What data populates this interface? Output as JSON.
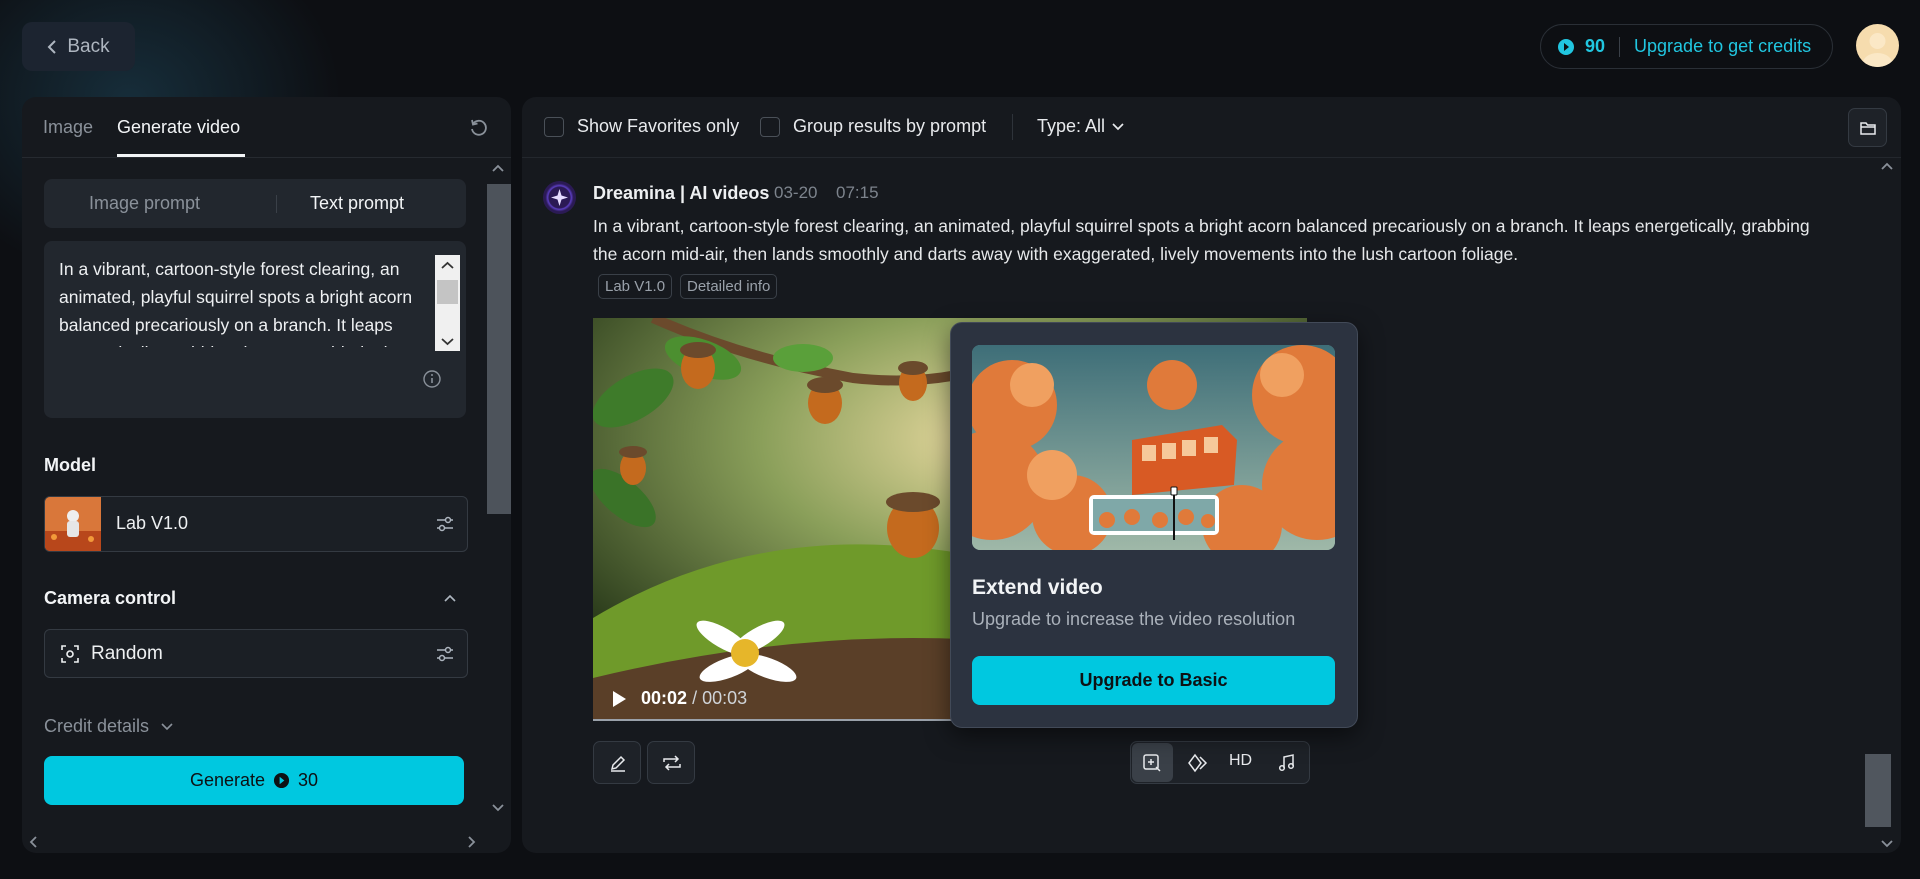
{
  "header": {
    "back_label": "Back",
    "credits_value": "90",
    "upgrade_label": "Upgrade to get credits"
  },
  "left_panel": {
    "tabs": [
      {
        "label": "Image",
        "active": false
      },
      {
        "label": "Generate video",
        "active": true
      }
    ],
    "prompt_mode": {
      "image_prompt": "Image prompt",
      "text_prompt": "Text prompt",
      "active": "Text prompt"
    },
    "prompt_text": "In a vibrant, cartoon-style forest clearing, an animated, playful squirrel spots a bright acorn balanced precariously on a branch. It leaps energetically, grabbing the acorn mid-air, then lands smoothly and darts away with exaggerated, lively movements into the lush cartoon foliage.",
    "model_label": "Model",
    "model_name": "Lab V1.0",
    "camera_label": "Camera control",
    "camera_value": "Random",
    "credit_details_label": "Credit details",
    "generate_label": "Generate",
    "generate_cost": "30"
  },
  "toolbar": {
    "favorites_label": "Show Favorites only",
    "group_label": "Group results by prompt",
    "type_label": "Type: All"
  },
  "result": {
    "source": "Dreamina | AI videos",
    "date": "03-20",
    "time": "07:15",
    "prompt": "In a vibrant, cartoon-style forest clearing, an animated, playful squirrel spots a bright acorn balanced precariously on a branch. It leaps energetically, grabbing the acorn mid-air, then lands smoothly and darts away with exaggerated, lively movements into the lush cartoon foliage.",
    "badges": [
      "Lab V1.0",
      "Detailed info"
    ],
    "video_time_current": "00:02",
    "video_time_total": "/ 00:03",
    "video_progress": 0.67,
    "hd_label": "HD"
  },
  "popover": {
    "title": "Extend video",
    "subtitle": "Upgrade to increase the video resolution",
    "button_label": "Upgrade to Basic"
  },
  "colors": {
    "accent": "#00c8e0",
    "background": "#0d0f13",
    "panel": "#16191e"
  }
}
